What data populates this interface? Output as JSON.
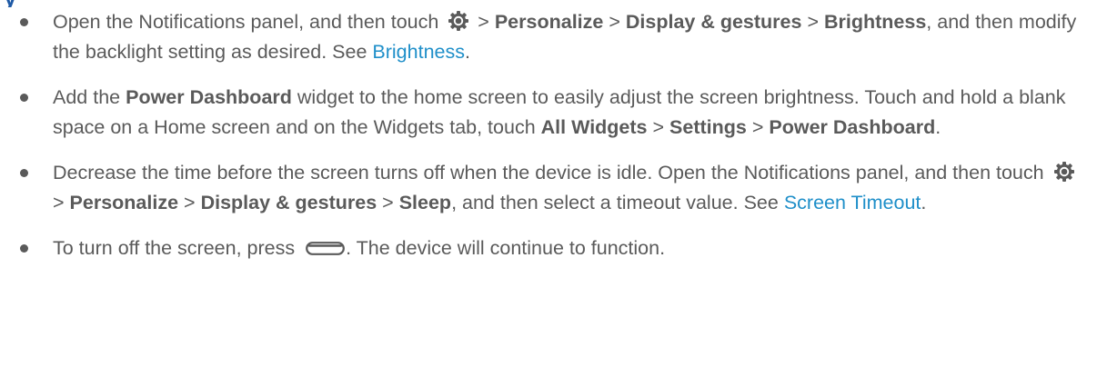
{
  "section": {
    "heading_fragment": "y"
  },
  "tips": [
    {
      "p1": "Open the Notifications panel, and then touch",
      "gt1": ">",
      "personalize": "Personalize",
      "gt2": ">",
      "display_gestures": "Display & gestures",
      "gt3": ">",
      "brightness": "Brightness",
      "p2": ", and then modify the backlight setting as desired. See",
      "link": "Brightness",
      "p3": "."
    },
    {
      "p1": "Add the",
      "power_dashboard": "Power Dashboard",
      "p2": "widget to the home screen to easily adjust the screen brightness. Touch and hold a blank space on a Home screen and on the Widgets tab, touch",
      "all_widgets": "All Widgets",
      "gt1": ">",
      "settings": "Settings",
      "gt2": ">",
      "power_dashboard_2": "Power Dashboard",
      "p3": "."
    },
    {
      "p1": "Decrease the time before the screen turns off when the device is idle. Open the Notifications panel, and then touch",
      "gt1": ">",
      "personalize": "Personalize",
      "gt2": ">",
      "display_gestures": "Display & gestures",
      "gt3": ">",
      "sleep": "Sleep",
      "p2": ", and then select a timeout value. See",
      "link": "Screen Timeout",
      "p3": "."
    },
    {
      "p1": "To turn off the screen, press",
      "p2": ". The device will continue to function."
    }
  ],
  "icons": {
    "settings": "gear-icon",
    "power_key": "power-button-icon"
  },
  "colors": {
    "body_text": "#5a5a5a",
    "link": "#1f8fc9",
    "heading": "#1f5aa6"
  }
}
